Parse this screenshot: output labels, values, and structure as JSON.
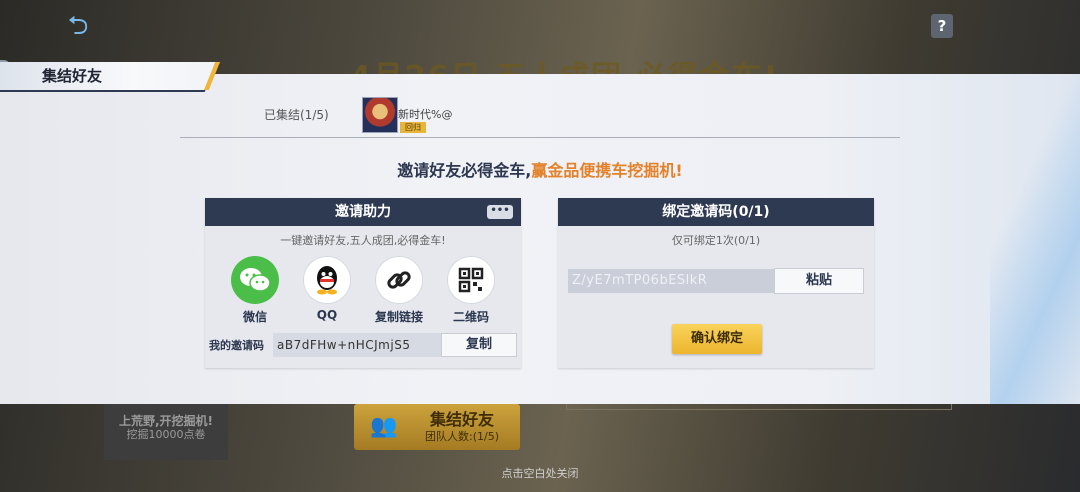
{
  "background": {
    "banner": "4月26日 五人成团 必得金车!",
    "card_title": "上荒野,开挖掘机!",
    "card_sub": "挖掘10000点卷",
    "gather_button": {
      "label": "集结好友",
      "sub": "团队人数:(1/5)"
    },
    "close_hint": "点击空白处关闭"
  },
  "modal": {
    "title": "集结好友",
    "gathered_label": "已集结(1/5)",
    "friend": {
      "name": "新时代%@",
      "badge": "回归"
    },
    "headline_part1": "邀请好友必得金车,",
    "headline_part2": "赢金品便携车挖掘机!"
  },
  "invite_card": {
    "title": "邀请助力",
    "more_label": "•••",
    "subtitle": "一键邀请好友,五人成团,必得金车!",
    "share_options": [
      {
        "label": "微信",
        "icon": "wechat-icon"
      },
      {
        "label": "QQ",
        "icon": "qq-icon"
      },
      {
        "label": "复制链接",
        "icon": "link-icon"
      },
      {
        "label": "二维码",
        "icon": "qrcode-icon"
      }
    ],
    "code_label": "我的邀请码",
    "code_value": "aB7dFHw+nHCJmjS5",
    "copy_label": "复制"
  },
  "bind_card": {
    "title": "绑定邀请码(0/1)",
    "subtitle": "仅可绑定1次(0/1)",
    "input_value": "Z/yE7mTP06bESlkR",
    "paste_label": "粘贴",
    "confirm_label": "确认绑定"
  },
  "colors": {
    "header": "#2e3a52",
    "accent_orange": "#e3822a",
    "confirm_yellow": "#f2c445",
    "wechat_green": "#4bbe4a"
  }
}
